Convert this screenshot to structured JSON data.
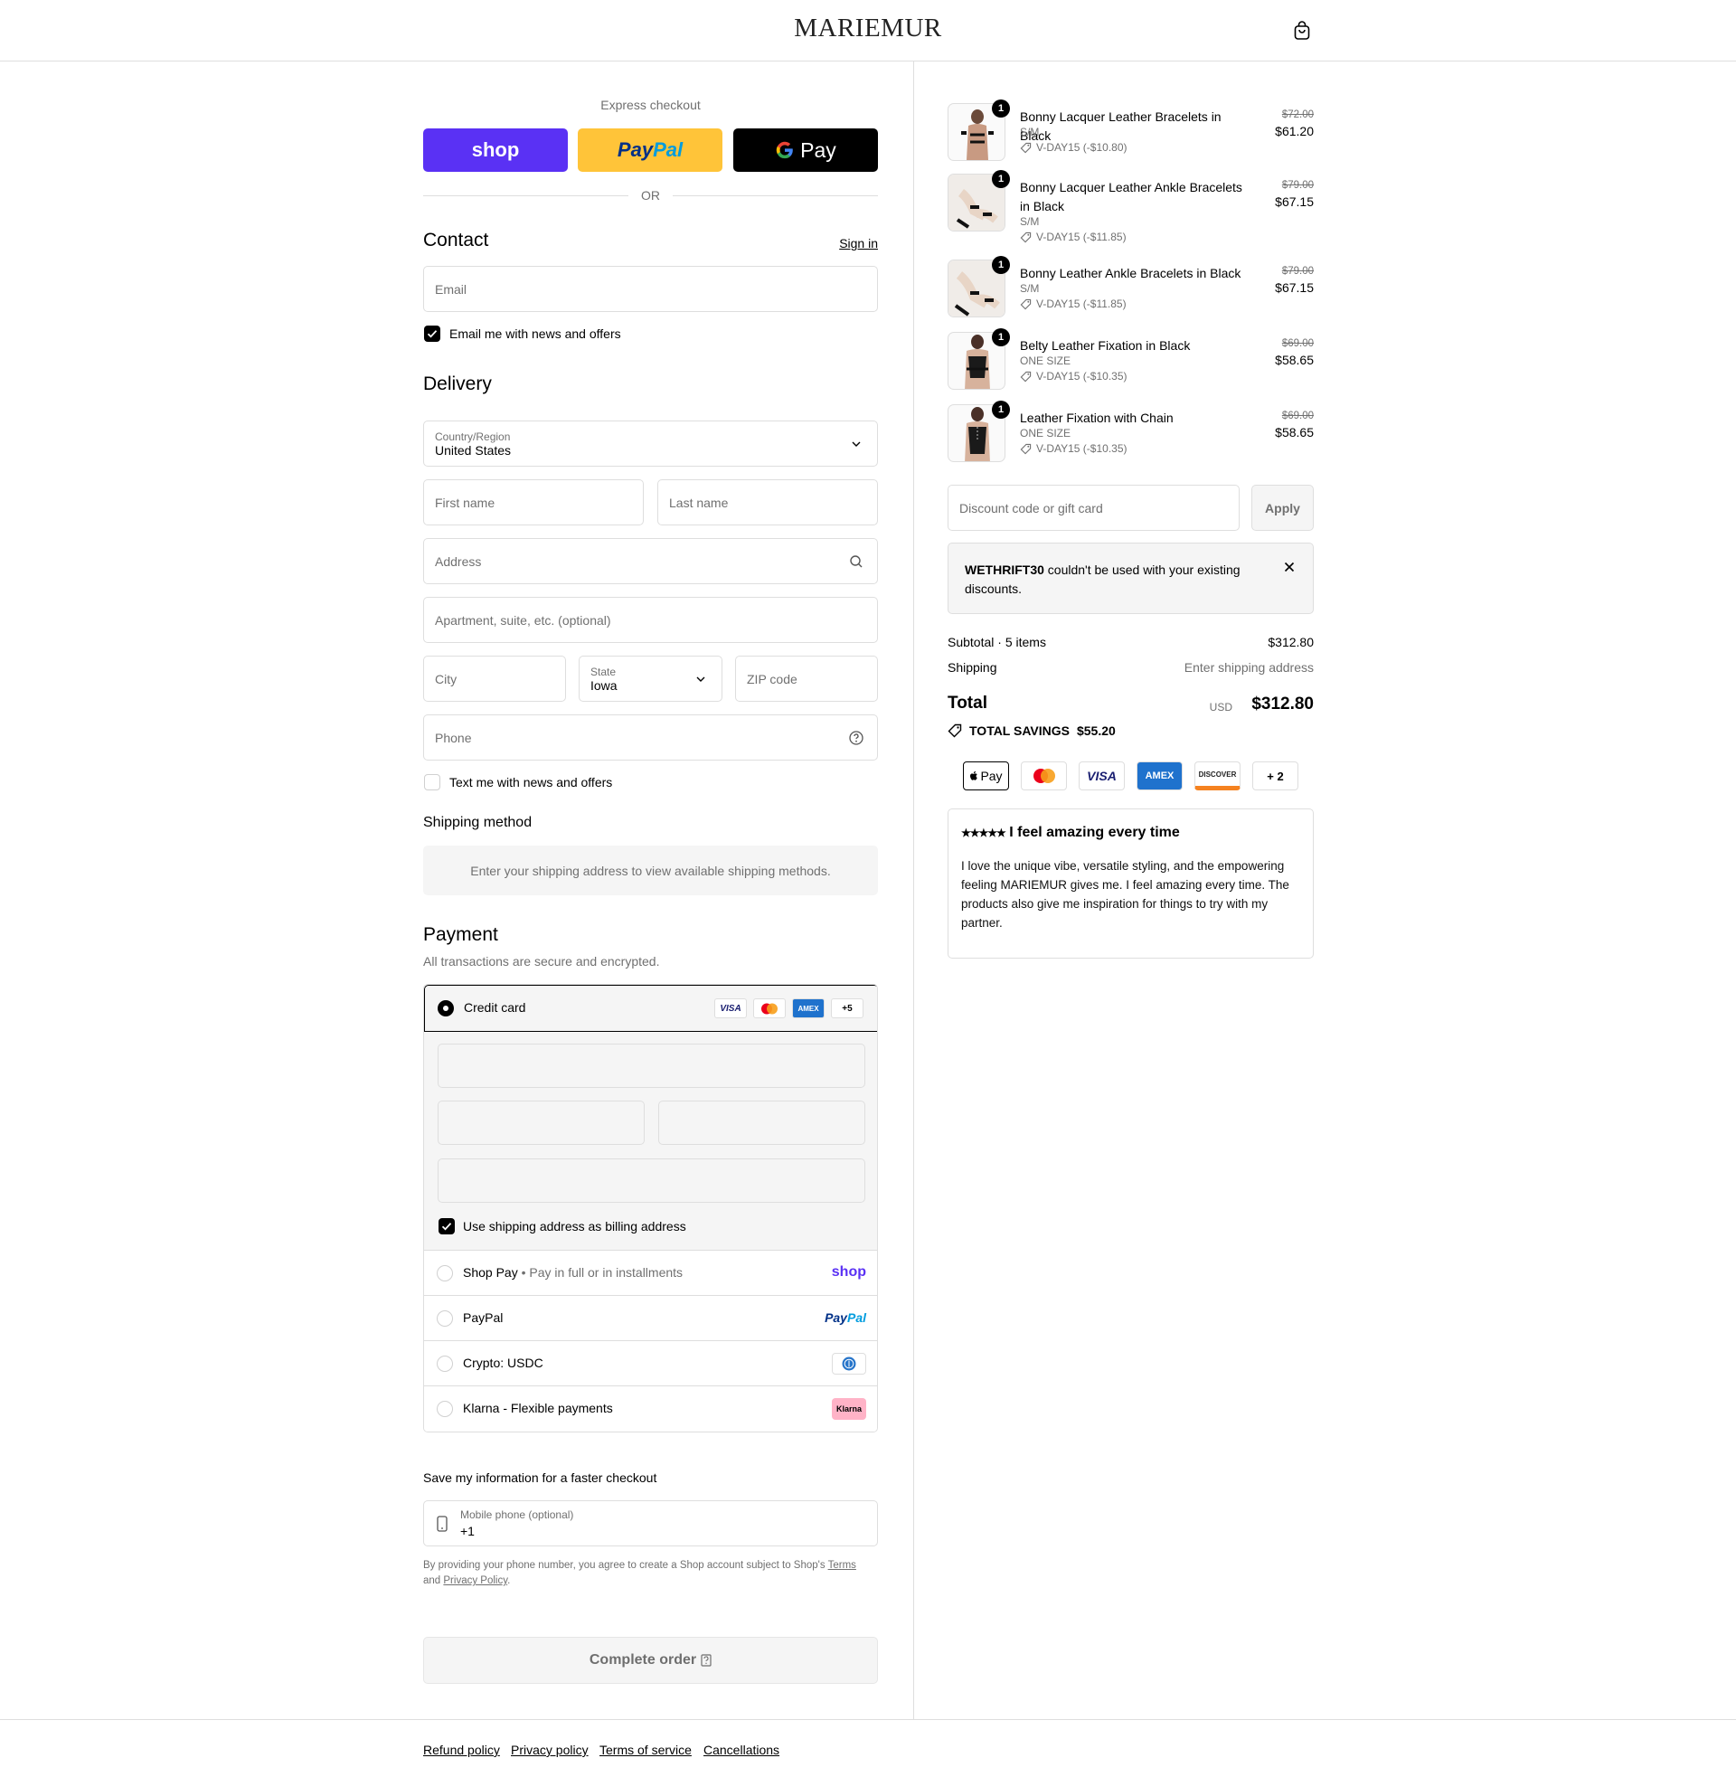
{
  "header": {
    "logo": "MARIEMUR",
    "cart_icon": "shopping-bag-icon"
  },
  "express": {
    "title": "Express checkout",
    "shop_label": "shop",
    "paypal_pay": "Pay",
    "paypal_pal": "Pal",
    "gpay_label": "Pay",
    "or_label": "OR",
    "colors": {
      "shop": "#5a31f4",
      "paypal": "#ffc439",
      "gpay": "#000000"
    }
  },
  "contact": {
    "title": "Contact",
    "sign_in": "Sign in",
    "email_placeholder": "Email",
    "news_opt_in": "Email me with news and offers",
    "news_checked": true
  },
  "delivery": {
    "title": "Delivery",
    "country_label": "Country/Region",
    "country_value": "United States",
    "first_name": "First name",
    "last_name": "Last name",
    "address": "Address",
    "apartment": "Apartment, suite, etc. (optional)",
    "city": "City",
    "state_label": "State",
    "state_value": "Iowa",
    "zip": "ZIP code",
    "phone": "Phone",
    "text_opt_in": "Text me with news and offers",
    "text_checked": false
  },
  "shipping_method": {
    "title": "Shipping method",
    "placeholder": "Enter your shipping address to view available shipping methods."
  },
  "payment": {
    "title": "Payment",
    "subtitle": "All transactions are secure and encrypted.",
    "credit_card_label": "Credit card",
    "card_brands": [
      "VISA",
      "MC",
      "AMEX",
      "+5"
    ],
    "billing_same": "Use shipping address as billing address",
    "billing_checked": true,
    "options": [
      {
        "label": "Shop Pay",
        "note": "Pay in full or in installments",
        "logo": "shop"
      },
      {
        "label": "PayPal",
        "logo_pay": "Pay",
        "logo_pal": "Pal"
      },
      {
        "label": "Crypto: USDC",
        "logo": "usdc-icon"
      },
      {
        "label": "Klarna - Flexible payments",
        "logo": "Klarna"
      }
    ]
  },
  "save_info": {
    "title": "Save my information for a faster checkout",
    "mobile_label": "Mobile phone (optional)",
    "mobile_value": "+1",
    "terms_prefix": "By providing your phone number, you agree to create a Shop account subject to Shop's",
    "terms_link": "Terms",
    "terms_and": "and",
    "privacy_link": "Privacy Policy",
    "terms_end": "."
  },
  "complete_order": {
    "label": "Complete order"
  },
  "footer": {
    "links": [
      "Refund policy",
      "Privacy policy",
      "Terms of service",
      "Cancellations"
    ]
  },
  "cart": {
    "items": [
      {
        "qty": "1",
        "name": "Bonny Lacquer Leather Bracelets in Black",
        "variant": "S/M",
        "discount": "V-DAY15 (-$10.80)",
        "old_price": "$72.00",
        "price": "$61.20"
      },
      {
        "qty": "1",
        "name": "Bonny Lacquer Leather Ankle Bracelets in Black",
        "variant": "S/M",
        "discount": "V-DAY15 (-$11.85)",
        "old_price": "$79.00",
        "price": "$67.15"
      },
      {
        "qty": "1",
        "name": "Bonny Leather Ankle Bracelets in Black",
        "variant": "S/M",
        "discount": "V-DAY15 (-$11.85)",
        "old_price": "$79.00",
        "price": "$67.15"
      },
      {
        "qty": "1",
        "name": "Belty Leather Fixation in Black",
        "variant": "ONE SIZE",
        "discount": "V-DAY15 (-$10.35)",
        "old_price": "$69.00",
        "price": "$58.65"
      },
      {
        "qty": "1",
        "name": "Leather Fixation with Chain",
        "variant": "ONE SIZE",
        "discount": "V-DAY15 (-$10.35)",
        "old_price": "$69.00",
        "price": "$58.65"
      }
    ],
    "discount_placeholder": "Discount code or gift card",
    "apply_label": "Apply",
    "notice_code": "WETHRIFT30",
    "notice_text": " couldn't be used with your existing discounts.",
    "subtotal_label": "Subtotal · 5 items",
    "subtotal_value": "$312.80",
    "shipping_label": "Shipping",
    "shipping_value": "Enter shipping address",
    "total_label": "Total",
    "total_currency": "USD",
    "total_value": "$312.80",
    "savings_label": "TOTAL SAVINGS",
    "savings_value": "$55.20",
    "pay_badges": [
      "Pay",
      "MC",
      "VISA",
      "AMEX",
      "DISCOVER",
      "+ 2"
    ]
  },
  "review": {
    "stars": "★★★★★",
    "title": "I feel amazing every time",
    "body": "I love the unique vibe, versatile styling, and the empowering feeling MARIEMUR gives me. I feel amazing every time. The products also give me inspiration for things to try with my partner."
  }
}
